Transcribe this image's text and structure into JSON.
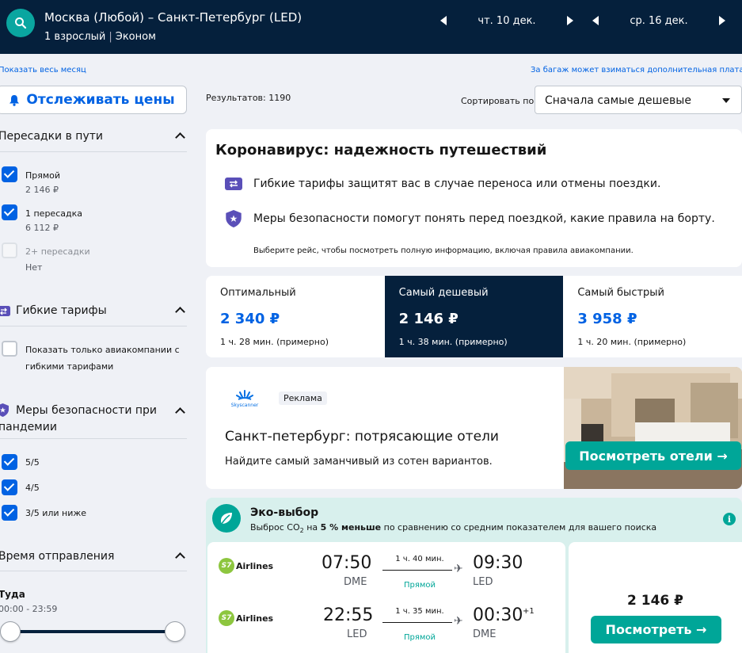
{
  "header": {
    "route": "Москва (Любой) – Санкт-Петербург (LED)",
    "passengers": "1 взрослый",
    "cabin": "Эконом",
    "depart_date": "чт. 10 дек.",
    "return_date": "ср. 16 дек.",
    "bg_color": "#05203c"
  },
  "top_links": {
    "show_month": "Показать весь месяц",
    "baggage_note": "За багаж может взиматься дополнительная плата"
  },
  "sidebar": {
    "track_prices": "Отслеживать цены",
    "stops": {
      "title": "Пересадки в пути",
      "options": [
        {
          "label": "Прямой",
          "price": "2 146 ₽",
          "checked": true
        },
        {
          "label": "1 пересадка",
          "price": "6 112 ₽",
          "checked": true
        },
        {
          "label": "2+ пересадки",
          "price": "Нет",
          "checked": false
        }
      ]
    },
    "flex": {
      "title": "Гибкие тарифы",
      "option_line1": "Показать только авиакомпании с",
      "option_line2": "гибкими тарифами"
    },
    "safety": {
      "title_line1": "Меры безопасности при",
      "title_line2": "пандемии",
      "options": [
        "5/5",
        "4/5",
        "3/5 или ниже"
      ]
    },
    "departure_time": {
      "title": "Время отправления",
      "direction": "Туда",
      "range": "00:00 - 23:59"
    }
  },
  "results": {
    "count_label": "Результатов: 1190",
    "sort_label": "Сортировать по",
    "sort_value": "Сначала самые дешевые"
  },
  "covid": {
    "title": "Коронавирус: надежность путешествий",
    "row1": "Гибкие тарифы защитят вас в случае переноса или отмены поездки.",
    "row2": "Меры безопасности помогут понять перед поездкой, какие правила на борту.",
    "note": "Выберите рейс, чтобы посмотреть полную информацию, включая правила авиакомпании."
  },
  "tabs": [
    {
      "name": "Оптимальный",
      "price": "2 340 ₽",
      "duration": "1 ч. 28 мин. (примерно)",
      "active": false
    },
    {
      "name": "Самый дешевый",
      "price": "2 146 ₽",
      "duration": "1 ч. 38 мин. (примерно)",
      "active": true
    },
    {
      "name": "Самый быстрый",
      "price": "3 958 ₽",
      "duration": "1 ч. 20 мин. (примерно)",
      "active": false
    }
  ],
  "ad": {
    "brand": "Skyscanner",
    "badge": "Реклама",
    "title": "Санкт-петербург: потрясающие отели",
    "subtitle": "Найдите самый заманчивый из сотен вариантов.",
    "button": "Посмотреть отели →"
  },
  "eco": {
    "title": "Эко-выбор",
    "sub_prefix": "Выброс CO",
    "sub_subscript": "2",
    "sub_middle": " на ",
    "sub_bold": "5 % меньше",
    "sub_suffix": " по сравнению со средним показателем для вашего поиска"
  },
  "flights": [
    {
      "airline": "Airlines",
      "dep_time": "07:50",
      "dep_apt": "DME",
      "duration": "1 ч. 40 мин.",
      "stops": "Прямой",
      "arr_time": "09:30",
      "arr_apt": "LED",
      "next_day": ""
    },
    {
      "airline": "Airlines",
      "dep_time": "22:55",
      "dep_apt": "LED",
      "duration": "1 ч. 35 мин.",
      "stops": "Прямой",
      "arr_time": "00:30",
      "arr_apt": "DME",
      "next_day": "+1"
    }
  ],
  "offer": {
    "price": "2 146 ₽",
    "button": "Посмотреть →"
  }
}
